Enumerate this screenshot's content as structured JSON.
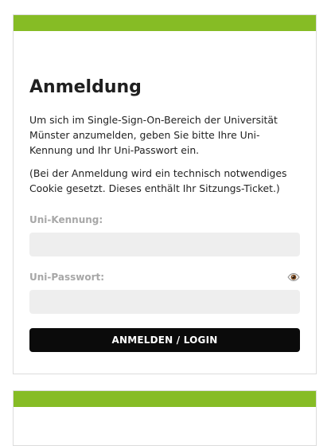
{
  "app": {
    "brand_color": "#86bc25",
    "surface_color": "#ffffff",
    "text_color": "#1f1f1f"
  },
  "login": {
    "title": "Anmeldung",
    "intro": "Um sich im Single-Sign-On-Bereich der Universität Münster anzumelden, geben Sie bitte Ihre Uni-Kennung und Ihr Uni-Passwort ein.",
    "note": "(Bei der Anmeldung wird ein technisch notwendiges Cookie gesetzt. Dieses enthält Ihr Sitzungs-Ticket.)",
    "username_label": "Uni-Kennung:",
    "username_value": "",
    "password_label": "Uni-Passwort:",
    "password_value": "",
    "button_label": "ANMELDEN / LOGIN",
    "password_toggle_icon": "eye-icon"
  }
}
